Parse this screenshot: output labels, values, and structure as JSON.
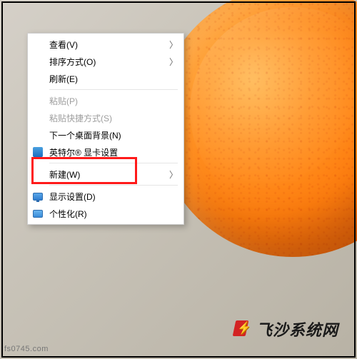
{
  "menu": {
    "view": "查看(V)",
    "sort": "排序方式(O)",
    "refresh": "刷新(E)",
    "paste": "粘贴(P)",
    "paste_shortcut": "粘贴快捷方式(S)",
    "next_bg": "下一个桌面背景(N)",
    "intel_gfx": "英特尔® 显卡设置",
    "new": "新建(W)",
    "display_settings": "显示设置(D)",
    "personalize": "个性化(R)"
  },
  "watermark": {
    "brand": "飞沙系统网",
    "url": "fs0745.com"
  }
}
